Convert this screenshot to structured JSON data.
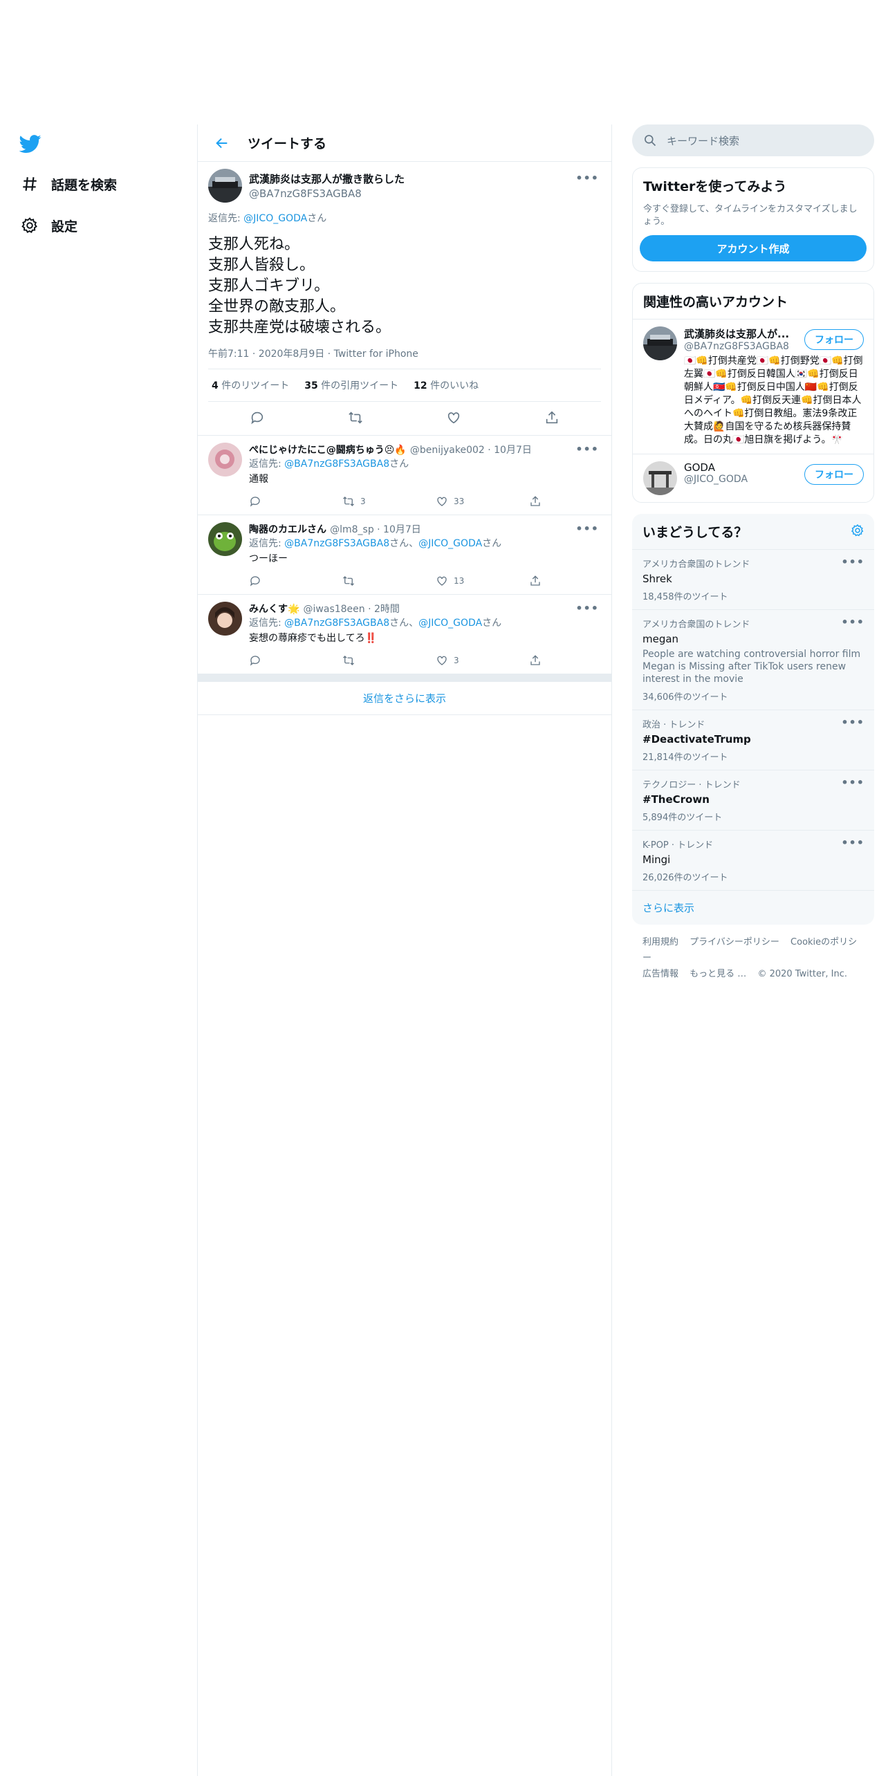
{
  "nav": {
    "explore_label": "話題を検索",
    "settings_label": "設定"
  },
  "header": {
    "title": "ツイートする"
  },
  "tweet": {
    "name": "武漢肺炎は支那人が撒き散らした",
    "handle": "@BA7nzG8FS3AGBA8",
    "reply_prefix": "返信先: ",
    "reply_to": "@JICO_GODA",
    "reply_suffix": "さん",
    "lines": [
      "支那人死ね。",
      "支那人皆殺し。",
      "支那人ゴキブリ。",
      "全世界の敵支那人。",
      "支那共産党は破壊される。"
    ],
    "time": "午前7:11 · 2020年8月9日 · Twitter for iPhone",
    "retweets": "4",
    "retweets_label": "件のリツイート",
    "quotes": "35",
    "quotes_label": "件の引用ツイート",
    "likes": "12",
    "likes_label": "件のいいね"
  },
  "replies": [
    {
      "name": "ぺにじゃけたにこ@闘病ちゅう😣🔥",
      "meta": "@benijyake002 · 10月7日",
      "reply_prefix": "返信先: ",
      "reply_to": "@BA7nzG8FS3AGBA8",
      "reply_to2": "",
      "reply_suffix": "さん",
      "text": "通報",
      "retweets": "3",
      "likes": "33"
    },
    {
      "name": "陶器のカエルさん",
      "meta": "@lm8_sp · 10月7日",
      "reply_prefix": "返信先: ",
      "reply_to": "@BA7nzG8FS3AGBA8",
      "reply_to2": "@JICO_GODA",
      "reply_suffix": "さん",
      "text": "つーほー",
      "retweets": "",
      "likes": "13"
    },
    {
      "name": "みんくす🌟",
      "meta": "@iwas18een · 2時間",
      "reply_prefix": "返信先: ",
      "reply_to": "@BA7nzG8FS3AGBA8",
      "reply_to2": "@JICO_GODA",
      "reply_suffix": "さん",
      "text": "妄想の蕁麻疹でも出してろ‼️",
      "retweets": "",
      "likes": "3"
    }
  ],
  "show_more_replies": "返信をさらに表示",
  "search": {
    "placeholder": "キーワード検索"
  },
  "signup": {
    "title": "Twitterを使ってみよう",
    "subtitle": "今すぐ登録して、タイムラインをカスタマイズしましょう。",
    "button": "アカウント作成"
  },
  "related": {
    "title": "関連性の高いアカウント",
    "accounts": [
      {
        "name": "武漢肺炎は支那人が...",
        "handle": "@BA7nzG8FS3AGBA8",
        "bio": "🇯🇵👊打倒共産党🇯🇵👊打倒野党🇯🇵👊打倒左翼🇯🇵👊打倒反日韓国人🇰🇷👊打倒反日朝鮮人🇰🇵👊打倒反日中国人🇨🇳👊打倒反日メディア。👊打倒反天連👊打倒日本人へのヘイト👊打倒日教組。憲法9条改正大賛成🙋自国を守るため核兵器保持賛成。日の丸🇯🇵旭日旗を掲げよう。🎌",
        "follow": "フォロー"
      },
      {
        "name": "GODA",
        "handle": "@JICO_GODA",
        "bio": "",
        "follow": "フォロー"
      }
    ]
  },
  "trends": {
    "title": "いまどうしてる？",
    "items": [
      {
        "context": "アメリカ合衆国のトレンド",
        "name": "Shrek",
        "desc": "",
        "count": "18,458件のツイート"
      },
      {
        "context": "アメリカ合衆国のトレンド",
        "name": "megan",
        "desc": "People are watching controversial horror film Megan is Missing after TikTok users renew interest in the movie",
        "count": "34,606件のツイート"
      },
      {
        "context": "政治 · トレンド",
        "name": "#DeactivateTrump",
        "desc": "",
        "count": "21,814件のツイート"
      },
      {
        "context": "テクノロジー · トレンド",
        "name": "#TheCrown",
        "desc": "",
        "count": "5,894件のツイート"
      },
      {
        "context": "K-POP · トレンド",
        "name": "Mingi",
        "desc": "",
        "count": "26,026件のツイート"
      }
    ],
    "show_more": "さらに表示"
  },
  "footer": {
    "terms": "利用規約",
    "privacy": "プライバシーポリシー",
    "cookie": "Cookieのポリシー",
    "ads": "広告情報",
    "more": "もっと見る …",
    "copyright": "© 2020 Twitter, Inc."
  },
  "colors": {
    "accent": "#1da1f2",
    "link": "#1b95e0",
    "muted": "#657786",
    "border": "#e6ecf0"
  }
}
